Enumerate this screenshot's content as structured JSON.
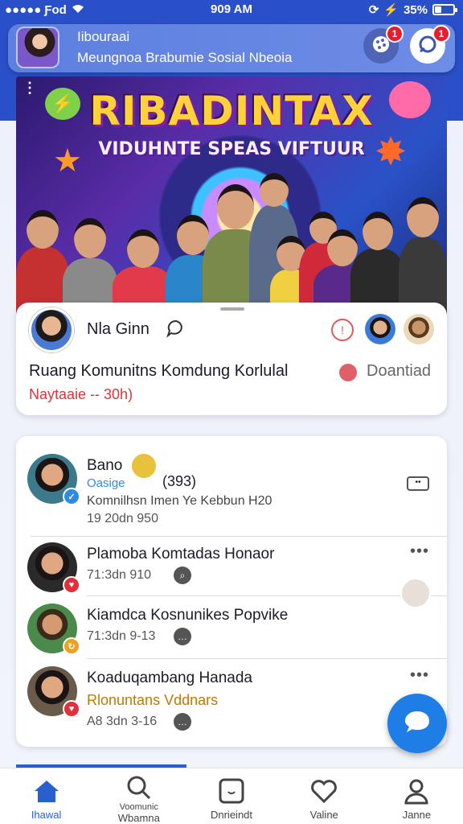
{
  "status_bar": {
    "carrier": "Ƒod",
    "time": "909 AM",
    "battery_text": "35%",
    "battery_level": 0.35
  },
  "header": {
    "title": "Iibouraai",
    "subtitle": "Meungnoa Brabumie Sosial Nbeoia",
    "settings_badge": "1",
    "chat_badge": "1"
  },
  "banner": {
    "title": "RIBADINTAX",
    "subtitle": "VIDUHNTE SPEAS VIFTUUR"
  },
  "featured": {
    "name": "Nla Ginn",
    "room_title": "Ruang Komunitns Komdung Korlulal",
    "download_label": "Doantiad",
    "meta": "Naytaaie -- 30h)"
  },
  "list": [
    {
      "title": "Bano",
      "tag": "Oasige",
      "count": "(393)",
      "subtitle": "Komnilhsn Imen Ye Kebbun H20",
      "time": "19 20dn 950",
      "badge_color": "#2f8be0"
    },
    {
      "title": "Plamoba Komtadas Honaor",
      "time": "71:3dn 910",
      "badge_color": "#e0303c"
    },
    {
      "title": "Kiamdca Kosnunikes Popvike",
      "time": "71:3dn 9-13",
      "badge_color": "#f0a020"
    },
    {
      "title": "Koaduqambang Hanada",
      "subtitle": "Rlonuntans Vddnars",
      "time": "A8 3dn 3-16",
      "badge_color": "#e0303c"
    }
  ],
  "nav": {
    "home": "Ihawal",
    "search_top": "Voomunic",
    "search_bottom": "Wbamna",
    "events": "Dnrieindt",
    "likes": "Valine",
    "profile": "Janne"
  },
  "colors": {
    "primary": "#2a50c9",
    "accent": "#2a5fd0",
    "fab": "#1f7de6",
    "badge": "#e51d2f"
  }
}
